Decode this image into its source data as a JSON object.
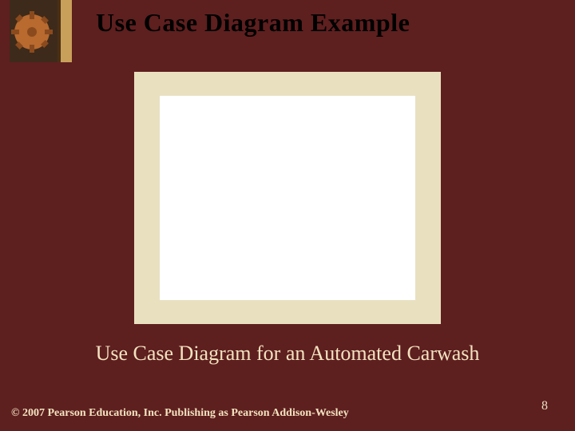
{
  "slide": {
    "title": "Use Case Diagram Example",
    "caption": "Use Case Diagram for an Automated Carwash",
    "copyright": "© 2007 Pearson Education, Inc. Publishing as Pearson Addison-Wesley",
    "page_number": "8"
  }
}
